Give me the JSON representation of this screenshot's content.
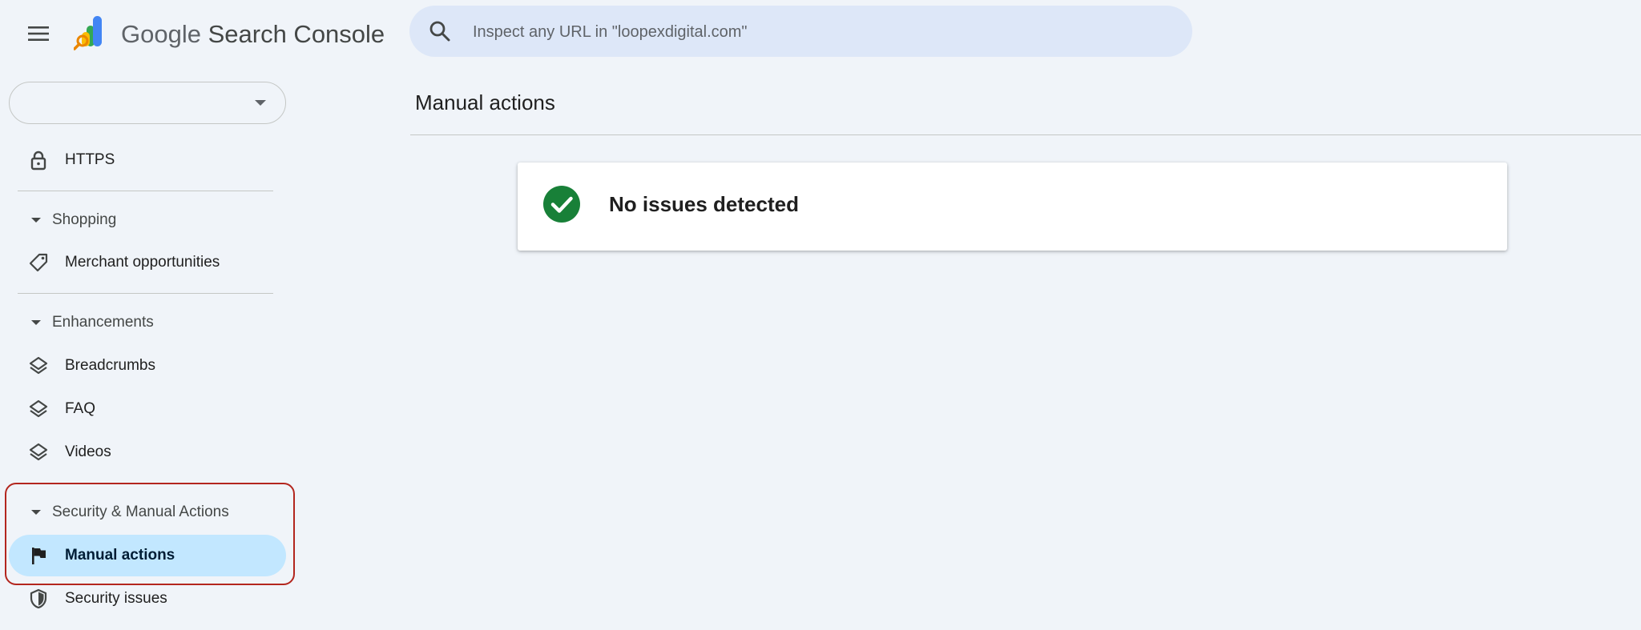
{
  "header": {
    "app_brand": "Google",
    "app_name": "Search Console",
    "search": {
      "placeholder": "Inspect any URL in \"loopexdigital.com\"",
      "value": ""
    }
  },
  "sidebar": {
    "property_selector": {
      "value": ""
    },
    "items": {
      "https": {
        "label": "HTTPS",
        "icon": "lock-icon"
      },
      "shopping": {
        "label": "Shopping"
      },
      "merchant_opportunities": {
        "label": "Merchant opportunities",
        "icon": "tag-icon"
      },
      "enhancements": {
        "label": "Enhancements"
      },
      "breadcrumbs": {
        "label": "Breadcrumbs",
        "icon": "layers-icon"
      },
      "faq": {
        "label": "FAQ",
        "icon": "layers-icon"
      },
      "videos": {
        "label": "Videos",
        "icon": "layers-icon"
      },
      "security_manual_actions": {
        "label": "Security & Manual Actions"
      },
      "manual_actions": {
        "label": "Manual actions",
        "icon": "flag-icon",
        "active": true
      },
      "security_issues": {
        "label": "Security issues",
        "icon": "shield-icon"
      }
    }
  },
  "main": {
    "page_title": "Manual actions",
    "status_card": {
      "message": "No issues detected",
      "icon": "check-circle-icon"
    }
  },
  "colors": {
    "background": "#f0f4f9",
    "search_bg": "#dde7f8",
    "active_nav_bg": "#c2e7ff",
    "success_green": "#188038",
    "highlight_red": "#b3261e"
  }
}
